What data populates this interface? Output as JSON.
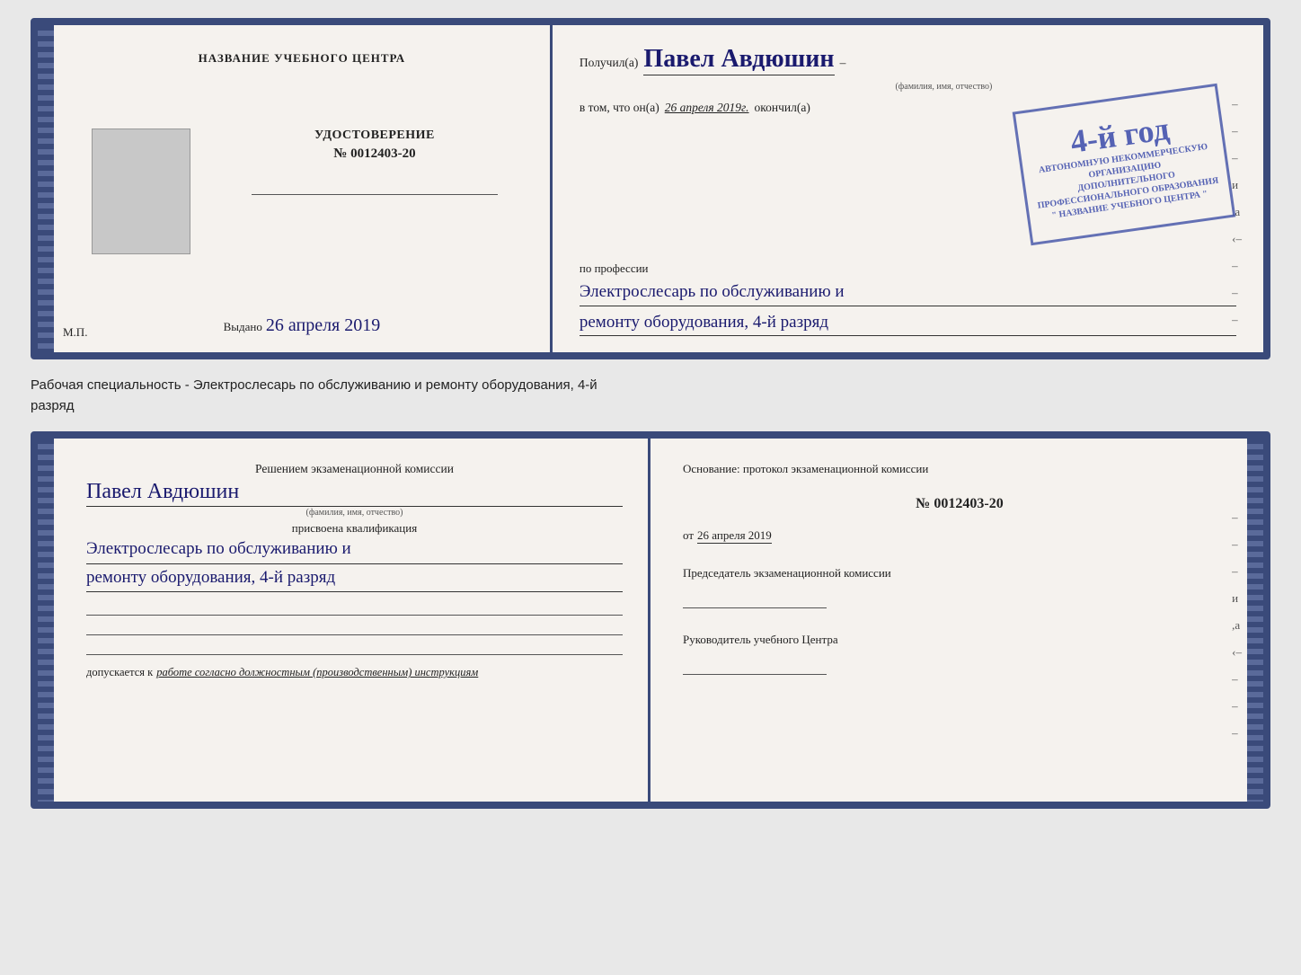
{
  "top_cert": {
    "left": {
      "title": "НАЗВАНИЕ УЧЕБНОГО ЦЕНТРА",
      "photo_alt": "фото",
      "udostoverenie_label": "УДОСТОВЕРЕНИЕ",
      "udostoverenie_number": "№ 0012403-20",
      "vydano_label": "Выдано",
      "vydano_date": "26 апреля 2019",
      "mp_label": "М.П."
    },
    "right": {
      "poluchil_label": "Получил(а)",
      "poluchil_name": "Павел Авдюшин",
      "fio_hint": "(фамилия, имя, отчество)",
      "dash": "–",
      "vtom_label": "в том, что он(а)",
      "vtom_date": "26 апреля 2019г.",
      "okonchil_label": "окончил(а)",
      "stamp_number": "4-й год",
      "stamp_line1": "АВТОНОМНУЮ НЕКОММЕРЧЕСКУЮ ОРГАНИЗАЦИЮ",
      "stamp_line2": "ДОПОЛНИТЕЛЬНОГО ПРОФЕССИОНАЛЬНОГО ОБРАЗОВАНИЯ",
      "stamp_line3": "\" НАЗВАНИЕ УЧЕБНОГО ЦЕНТРА \"",
      "profession_label": "по профессии",
      "profession_value": "Электрослесарь по обслуживанию и",
      "profession_value2": "ремонту оборудования, 4-й разряд"
    }
  },
  "separator": {
    "text_line1": "Рабочая специальность - Электрослесарь по обслуживанию и ремонту оборудования, 4-й",
    "text_line2": "разряд"
  },
  "bottom_cert": {
    "left": {
      "resheniye_label": "Решением экзаменационной комиссии",
      "person_name": "Павел Авдюшин",
      "fio_hint": "(фамилия, имя, отчество)",
      "prisvoena_label": "присвоена квалификация",
      "qualification_line1": "Электрослесарь по обслуживанию и",
      "qualification_line2": "ремонту оборудования, 4-й разряд",
      "dopuskaetsya_label": "допускается к",
      "dopuskaetsya_value": "работе согласно должностным (производственным) инструкциям"
    },
    "right": {
      "osnovaniye_label": "Основание: протокол экзаменационной комиссии",
      "osnovaniye_number": "№ 0012403-20",
      "ot_label": "от",
      "ot_date": "26 апреля 2019",
      "predsedatel_label": "Председатель экзаменационной комиссии",
      "rukovoditel_label": "Руководитель учебного Центра"
    }
  },
  "dashes": [
    "–",
    "–",
    "–",
    "и",
    ",а",
    "‹–",
    "–",
    "–",
    "–"
  ],
  "dashes2": [
    "–",
    "–",
    "–",
    "и",
    ",а",
    "‹–",
    "–",
    "–",
    "–"
  ]
}
